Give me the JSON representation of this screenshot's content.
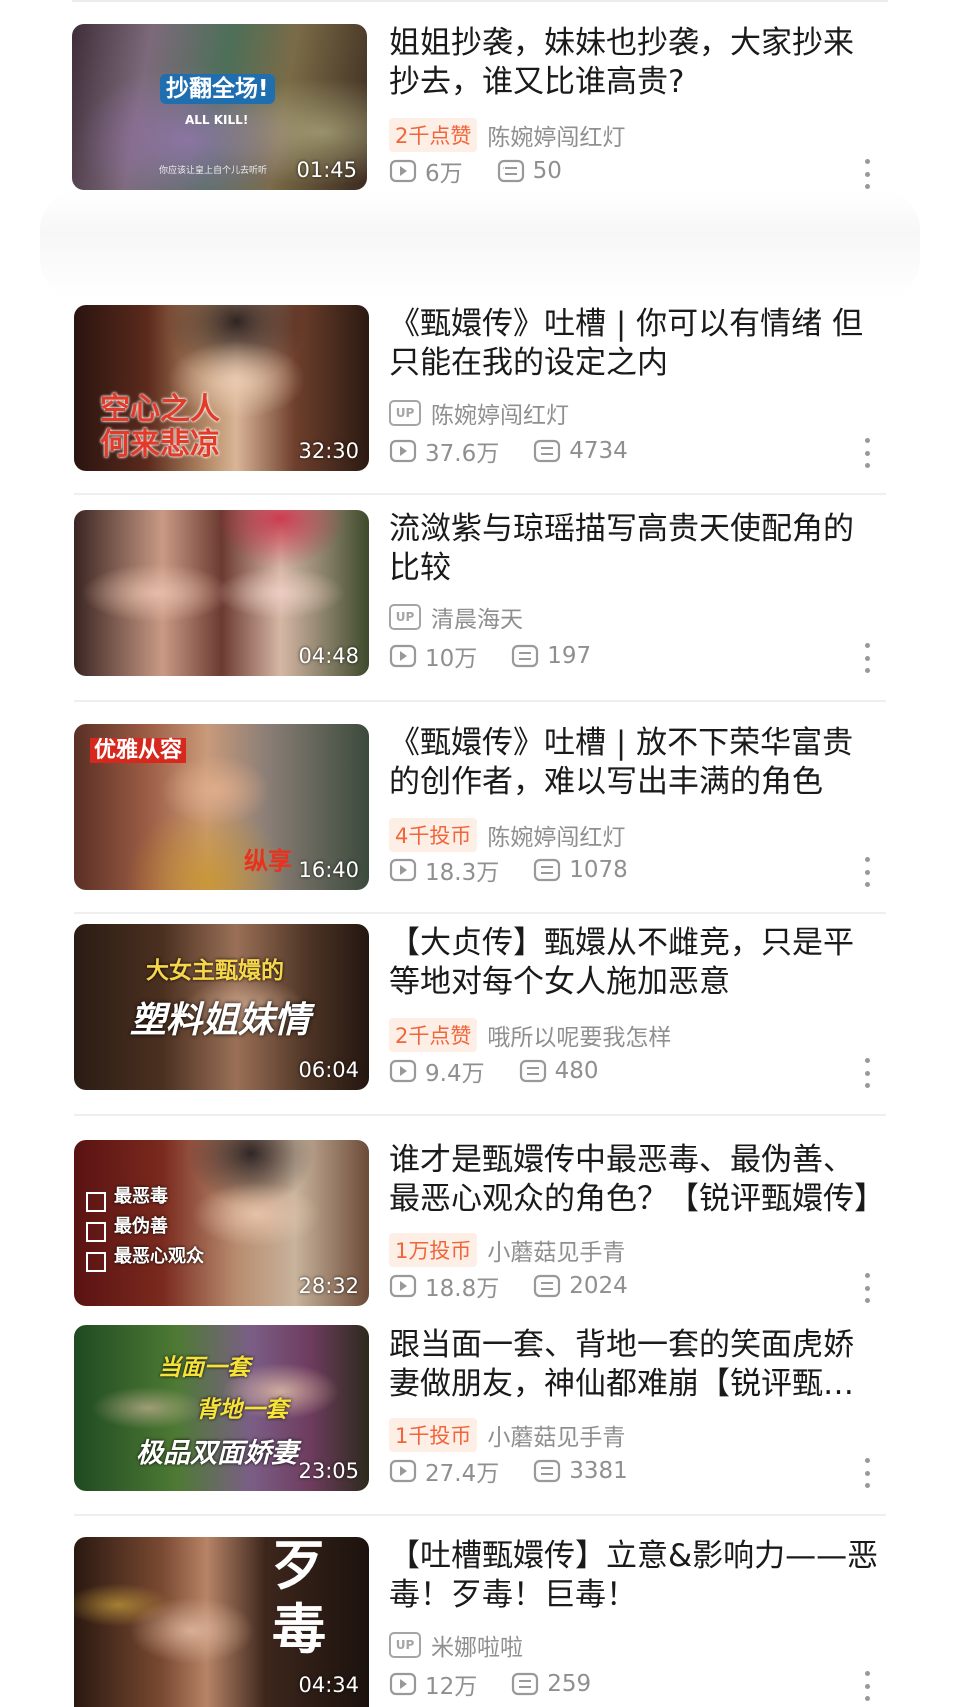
{
  "items": [
    {
      "title": "姐姐抄袭，妹妹也抄袭，大家抄来抄去，谁又比谁高贵?",
      "badge": "2千点赞",
      "author": "陈婉婷闯红灯",
      "views": "6万",
      "comments": "50",
      "duration": "01:45",
      "overlay": [
        "抄翻全场!",
        "ALL KILL!",
        "你应该让皇上自个儿去听听"
      ]
    },
    {
      "title": "《甄嬛传》吐槽 | 你可以有情绪 但只能在我的设定之内",
      "author": "陈婉婷闯红灯",
      "views": "37.6万",
      "comments": "4734",
      "duration": "32:30",
      "overlay": [
        "空心之人\n何来悲凉"
      ]
    },
    {
      "title": "流潋紫与琼瑶描写高贵天使配角的比较",
      "author": "清晨海天",
      "views": "10万",
      "comments": "197",
      "duration": "04:48",
      "overlay": []
    },
    {
      "title": "《甄嬛传》吐槽 | 放不下荣华富贵的创作者，难以写出丰满的角色",
      "badge": "4千投币",
      "author": "陈婉婷闯红灯",
      "views": "18.3万",
      "comments": "1078",
      "duration": "16:40",
      "overlay": [
        "优雅从容",
        "纵享"
      ]
    },
    {
      "title": "【大贞传】甄嬛从不雌竞，只是平等地对每个女人施加恶意",
      "badge": "2千点赞",
      "author": "哦所以呢要我怎样",
      "views": "9.4万",
      "comments": "480",
      "duration": "06:04",
      "overlay": [
        "大女主甄嬛的",
        "塑料姐妹情"
      ]
    },
    {
      "title": "谁才是甄嬛传中最恶毒、最伪善、最恶心观众的角色？【锐评甄嬛传】",
      "badge": "1万投币",
      "author": "小蘑菇见手青",
      "views": "18.8万",
      "comments": "2024",
      "duration": "28:32",
      "overlay": [
        "最恶毒\n最伪善\n最恶心观众"
      ]
    },
    {
      "title": "跟当面一套、背地一套的笑面虎娇妻做朋友，神仙都难崩【锐评甄嬛传】",
      "badge": "1千投币",
      "author": "小蘑菇见手青",
      "views": "27.4万",
      "comments": "3381",
      "duration": "23:05",
      "overlay": [
        "当面一套",
        "背地一套",
        "极品双面娇妻"
      ]
    },
    {
      "title": "【吐槽甄嬛传】立意&影响力——恶毒！歹毒！巨毒！",
      "author": "米娜啦啦",
      "views": "12万",
      "comments": "259",
      "duration": "04:34",
      "overlay": [
        "歹\n毒"
      ]
    }
  ],
  "up_label": "UP",
  "colors": {
    "badge_text": "#f1653a",
    "badge_bg": "#fdeee6",
    "meta": "#8f8f8f",
    "title": "#1a1a1a"
  },
  "icons": {
    "views": "play-count-icon",
    "comments": "danmaku-count-icon",
    "more": "more-vertical-icon"
  }
}
